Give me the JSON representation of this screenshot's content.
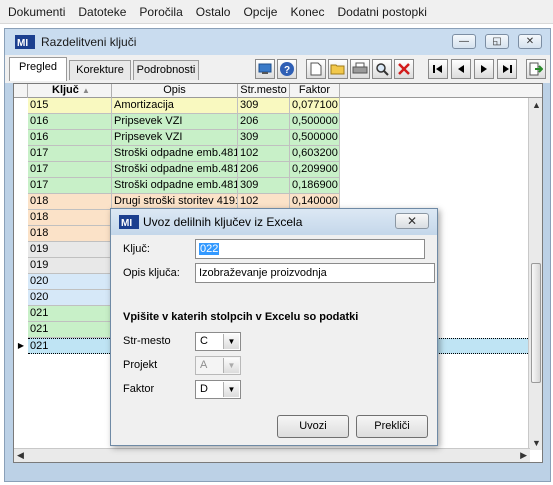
{
  "menu": [
    "Dokumenti",
    "Datoteke",
    "Poročila",
    "Ostalo",
    "Opcije",
    "Konec",
    "Dodatni postopki"
  ],
  "window": {
    "title": "Razdelitveni ključi",
    "controls": {
      "minimize": "—",
      "restore": "◱",
      "close": "✕"
    }
  },
  "tabs": [
    "Pregled",
    "Korekture",
    "Podrobnosti"
  ],
  "grid": {
    "columns": [
      "Ključ",
      "Opis",
      "Str.mesto",
      "Faktor"
    ],
    "rows": [
      {
        "kljuc": "015",
        "opis": "Amortizacija",
        "mesto": "309",
        "faktor": "0,077100",
        "color": "#f9f9c0"
      },
      {
        "kljuc": "016",
        "opis": "Pripsevek VZI",
        "mesto": "206",
        "faktor": "0,500000",
        "color": "#c8f0c8"
      },
      {
        "kljuc": "016",
        "opis": "Pripsevek VZI",
        "mesto": "309",
        "faktor": "0,500000",
        "color": "#c8f0c8"
      },
      {
        "kljuc": "017",
        "opis": "Stroški odpadne emb.4810",
        "mesto": "102",
        "faktor": "0,603200",
        "color": "#c8f0c8"
      },
      {
        "kljuc": "017",
        "opis": "Stroški odpadne emb.4810",
        "mesto": "206",
        "faktor": "0,209900",
        "color": "#c8f0c8"
      },
      {
        "kljuc": "017",
        "opis": "Stroški odpadne emb.4810",
        "mesto": "309",
        "faktor": "0,186900",
        "color": "#c8f0c8"
      },
      {
        "kljuc": "018",
        "opis": "Drugi stroški storitev 4191",
        "mesto": "102",
        "faktor": "0,140000",
        "color": "#fbe2c8"
      },
      {
        "kljuc": "018",
        "opis": "",
        "mesto": "",
        "faktor": "",
        "color": "#fbe2c8"
      },
      {
        "kljuc": "018",
        "opis": "",
        "mesto": "",
        "faktor": "",
        "color": "#fbe2c8"
      },
      {
        "kljuc": "019",
        "opis": "",
        "mesto": "",
        "faktor": "",
        "color": "#e8e8e8"
      },
      {
        "kljuc": "019",
        "opis": "",
        "mesto": "",
        "faktor": "",
        "color": "#e8e8e8"
      },
      {
        "kljuc": "020",
        "opis": "",
        "mesto": "",
        "faktor": "",
        "color": "#d6e8f8"
      },
      {
        "kljuc": "020",
        "opis": "",
        "mesto": "",
        "faktor": "",
        "color": "#d6e8f8"
      },
      {
        "kljuc": "021",
        "opis": "",
        "mesto": "",
        "faktor": "",
        "color": "#c8f0c8"
      },
      {
        "kljuc": "021",
        "opis": "",
        "mesto": "",
        "faktor": "",
        "color": "#c8f0c8"
      },
      {
        "kljuc": "021",
        "opis": "",
        "mesto": "",
        "faktor": "",
        "color": "#bfe4f4",
        "selected": true
      }
    ]
  },
  "dialog": {
    "title": "Uvoz delilnih ključev iz Excela",
    "close": "✕",
    "kljuc_label": "Ključ:",
    "kljuc_value": "022",
    "opis_label": "Opis ključa:",
    "opis_value": "Izobraževanje proizvodnja",
    "section_title": "Vpišite v katerih stolpcih v Excelu so podatki",
    "strmesto_label": "Str-mesto",
    "strmesto_value": "C",
    "projekt_label": "Projekt",
    "projekt_value": "A",
    "faktor_label": "Faktor",
    "faktor_value": "D",
    "ok_label": "Uvozi",
    "cancel_label": "Prekliči"
  }
}
